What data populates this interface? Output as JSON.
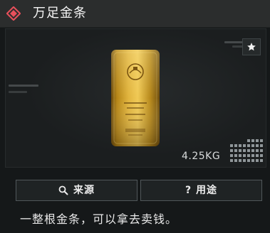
{
  "header": {
    "title": "万足金条",
    "icon": "diamond-emblem-icon",
    "accent_color": "#e8505b"
  },
  "item": {
    "image": "gold-bar-icon",
    "weight": "4.25KG",
    "size_indicator": "grid-icon"
  },
  "preview": {
    "favorite_icon": "star-icon"
  },
  "actions": {
    "source_label": "来源",
    "usage_label": "用途"
  },
  "description": "一整根金条，可以拿去卖钱。"
}
